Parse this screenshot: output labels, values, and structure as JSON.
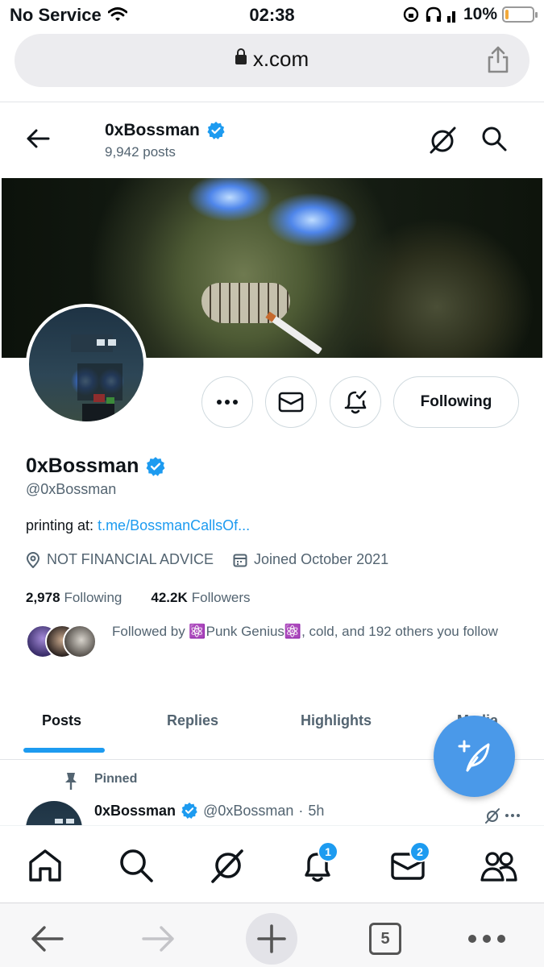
{
  "status_bar": {
    "carrier": "No Service",
    "time": "02:38",
    "battery": "10%",
    "battery_level": 0.1
  },
  "browser": {
    "url": "x.com",
    "tabs_count": "5"
  },
  "header": {
    "name": "0xBossman",
    "posts": "9,942 posts"
  },
  "profile": {
    "name": "0xBossman",
    "handle": "@0xBossman",
    "bio_prefix": "printing at: ",
    "bio_link": "t.me/BossmanCallsOf...",
    "location": "NOT FINANCIAL ADVICE",
    "joined": "Joined October 2021",
    "following_count": "2,978",
    "following_label": "Following",
    "followers_count": "42.2K",
    "followers_label": "Followers",
    "followed_by": "Followed by ⚛️Punk Genius⚛️, cold, and 192 others you follow",
    "following_button": "Following"
  },
  "tabs": [
    {
      "label": "Posts",
      "active": true
    },
    {
      "label": "Replies",
      "active": false
    },
    {
      "label": "Highlights",
      "active": false
    },
    {
      "label": "Media",
      "active": false
    }
  ],
  "pinned_post": {
    "pinned_label": "Pinned",
    "name": "0xBossman",
    "handle": "@0xBossman",
    "sep": "·",
    "time": "5h"
  },
  "tabbar": {
    "notifications_badge": "1",
    "messages_badge": "2"
  },
  "colors": {
    "accent": "#1d9bf0",
    "fab": "#4a99e9",
    "text": "#0f1419",
    "muted": "#536471"
  },
  "icons": [
    "wifi-icon",
    "lock-icon",
    "share-icon",
    "back-arrow-icon",
    "verified-icon",
    "grok-icon",
    "search-icon",
    "more-icon",
    "mail-icon",
    "bell-check-icon",
    "location-icon",
    "calendar-icon",
    "compose-icon",
    "pin-icon",
    "home-icon",
    "bell-icon",
    "people-icon",
    "plus-icon",
    "tabs-icon"
  ]
}
